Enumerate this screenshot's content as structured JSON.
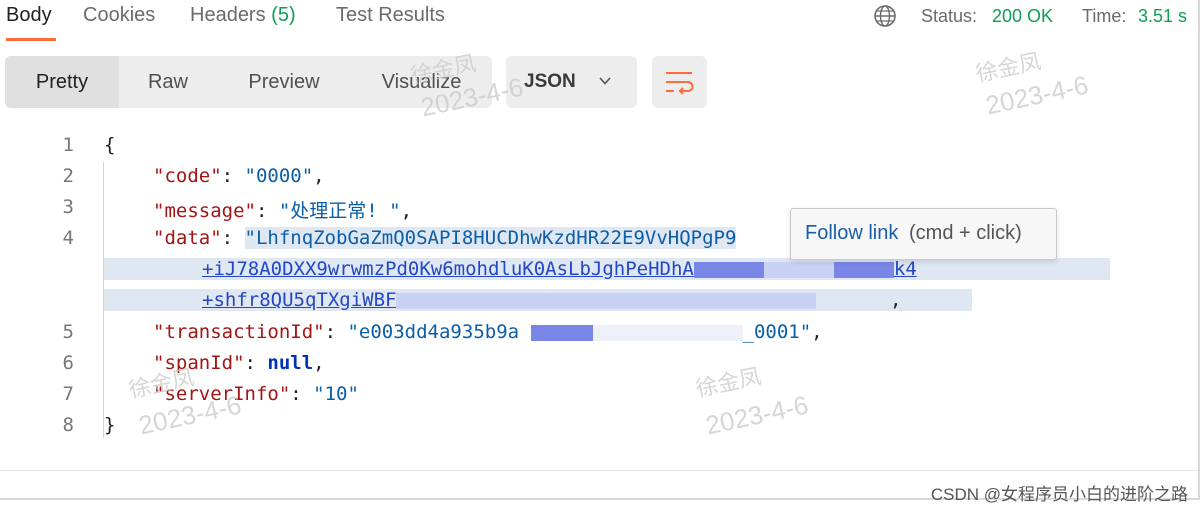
{
  "tabs": [
    {
      "label": "Body"
    },
    {
      "label": "Cookies"
    },
    {
      "label": "Headers",
      "count": "(5)"
    },
    {
      "label": "Test Results"
    }
  ],
  "status": {
    "status_label": "Status:",
    "status_value": "200 OK",
    "time_label": "Time:",
    "time_value": "3.51 s",
    "value_color": "#0f9d58"
  },
  "view_modes": [
    "Pretty",
    "Raw",
    "Preview",
    "Visualize"
  ],
  "format_select": {
    "value": "JSON"
  },
  "code": {
    "line_numbers": [
      "1",
      "2",
      "3",
      "4",
      "5",
      "6",
      "7",
      "8"
    ],
    "open_brace": "{",
    "close_brace": "}",
    "code_key": "\"code\"",
    "code_val": "\"0000\"",
    "message_key": "\"message\"",
    "message_val": "\"处理正常! \"",
    "data_key": "\"data\"",
    "data_val_1": "\"LhfnqZobGaZmQ0SAPI8HUCDhwKzdHR22E9VvHQPgP9",
    "data_val_2": "+iJ78A0DXX9wrwmzPd0Kw6mohdluK0AsLbJghPeHDhA",
    "data_val_2_tail": "k4",
    "data_val_3": "+shfr8QU5qTXgiWBF",
    "transaction_key": "\"transactionId\"",
    "transaction_val_start": "\"e003dd4a935b9a",
    "transaction_val_end": "_0001\"",
    "span_key": "\"spanId\"",
    "span_val": "null",
    "server_key": "\"serverInfo\"",
    "server_val": "\"10\""
  },
  "tooltip": {
    "link_text": "Follow link",
    "hint": "(cmd + click)"
  },
  "watermark": {
    "name": "徐金凤",
    "date": "2023-4-6"
  },
  "credit": "CSDN @女程序员小白的进阶之路"
}
